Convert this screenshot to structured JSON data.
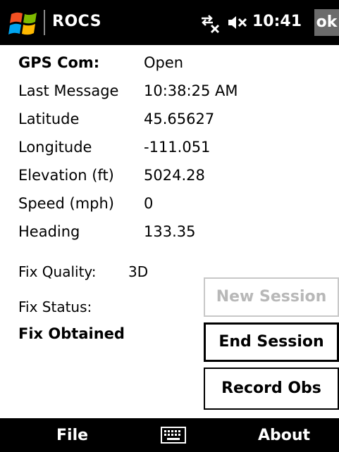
{
  "header": {
    "app_title": "ROCS",
    "clock": "10:41",
    "ok_label": "ok",
    "icons": [
      "windows-start-icon",
      "connectivity-icon",
      "volume-muted-icon"
    ]
  },
  "gps": {
    "rows": [
      {
        "label": "GPS Com:",
        "value": "Open"
      },
      {
        "label": "Last Message",
        "value": "10:38:25 AM"
      },
      {
        "label": "Latitude",
        "value": "45.65627"
      },
      {
        "label": "Longitude",
        "value": "-111.051"
      },
      {
        "label": "Elevation (ft)",
        "value": "5024.28"
      },
      {
        "label": "Speed (mph)",
        "value": "0"
      },
      {
        "label": "Heading",
        "value": "133.35"
      }
    ],
    "fix_quality_label": "Fix Quality:",
    "fix_quality_value": "3D",
    "fix_status_label": "Fix Status:",
    "fix_status_value": "Fix Obtained"
  },
  "actions": {
    "new_session": "New Session",
    "end_session": "End Session",
    "record_obs": "Record Obs"
  },
  "menu": {
    "left": "File",
    "right": "About",
    "center_icon": "keyboard-icon"
  },
  "colors": {
    "bar_background": "#000000",
    "ok_background": "#6b6b6b",
    "disabled_text": "#b8b8b8"
  }
}
